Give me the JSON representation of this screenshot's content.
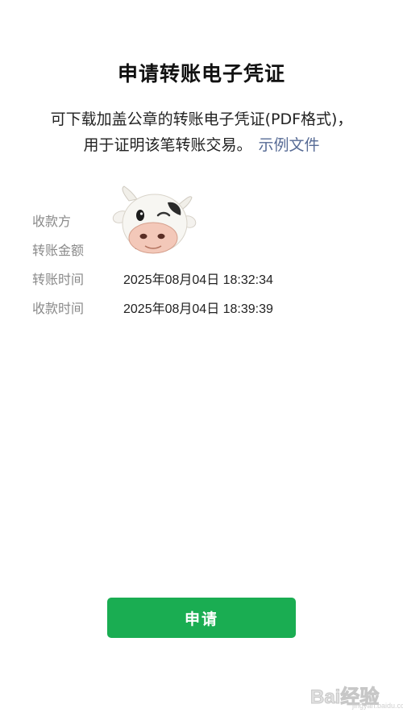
{
  "title": "申请转账电子凭证",
  "description": {
    "line1": "可下载加盖公章的转账电子凭证(PDF格式)，",
    "line2": "用于证明该笔转账交易。",
    "link": "示例文件"
  },
  "details": {
    "payee_label": "收款方",
    "amount_label": "转账金额",
    "transfer_time_label": "转账时间",
    "transfer_time_value": "2025年08月04日 18:32:34",
    "receive_time_label": "收款时间",
    "receive_time_value": "2025年08月04日 18:39:39"
  },
  "avatar_icon": "cow-avatar-icon",
  "apply_button_label": "申请",
  "accent_color": "#1aad52",
  "link_color": "#576b95",
  "watermark": {
    "text": "Bai经验",
    "sub": "jingyan.baidu.com"
  }
}
